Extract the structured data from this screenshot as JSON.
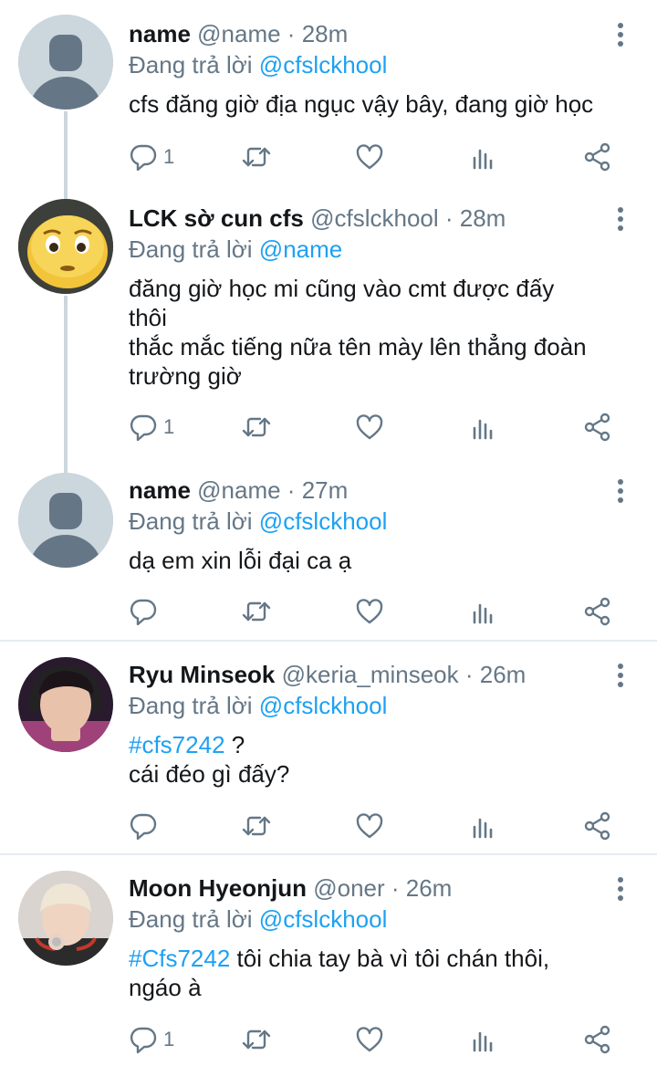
{
  "tweets": [
    {
      "name": "name",
      "meta": "@name · 28m",
      "reply_prefix": "Đang trả lời",
      "reply_to": "@cfslckhool",
      "lines": [
        "cfs đăng giờ địa ngục vậy bây, đang giờ học"
      ],
      "reply_count": "1"
    },
    {
      "name": "LCK sờ cun cfs",
      "meta": "@cfslckhool · 28m",
      "reply_prefix": "Đang trả lời",
      "reply_to": "@name",
      "lines": [
        "đăng giờ học mi cũng vào cmt được đấy",
        "thôi",
        "thắc mắc tiếng nữa tên mày lên thẳng đoàn",
        "trường giờ"
      ],
      "reply_count": "1"
    },
    {
      "name": "name",
      "meta": "@name · 27m",
      "reply_prefix": "Đang trả lời",
      "reply_to": "@cfslckhool",
      "lines": [
        "dạ em xin lỗi đại ca ạ"
      ],
      "reply_count": ""
    },
    {
      "name": "Ryu Minseok",
      "meta": "@keria_minseok · 26m",
      "reply_prefix": "Đang trả lời",
      "reply_to": "@cfslckhool",
      "hashtag": "#cfs7242",
      "line1_rest": " ?",
      "line2": "cái đéo gì đấy?",
      "reply_count": ""
    },
    {
      "name": "Moon Hyeonjun",
      "meta": "@oner · 26m",
      "reply_prefix": "Đang trả lời",
      "reply_to": "@cfslckhool",
      "hashtag": "#Cfs7242",
      "line1_rest": " tôi chia tay bà vì tôi chán thôi,",
      "line2": "ngáo à",
      "reply_count": "1"
    }
  ],
  "icons": {
    "reply": "reply-icon",
    "retweet": "retweet-icon",
    "like": "heart-icon",
    "analytics": "analytics-icon",
    "share": "share-icon",
    "more": "more-vertical-icon"
  },
  "colors": {
    "accent": "#1da1f2",
    "secondary_text": "#657786",
    "placeholder_avatar": "#ccd6dd"
  }
}
